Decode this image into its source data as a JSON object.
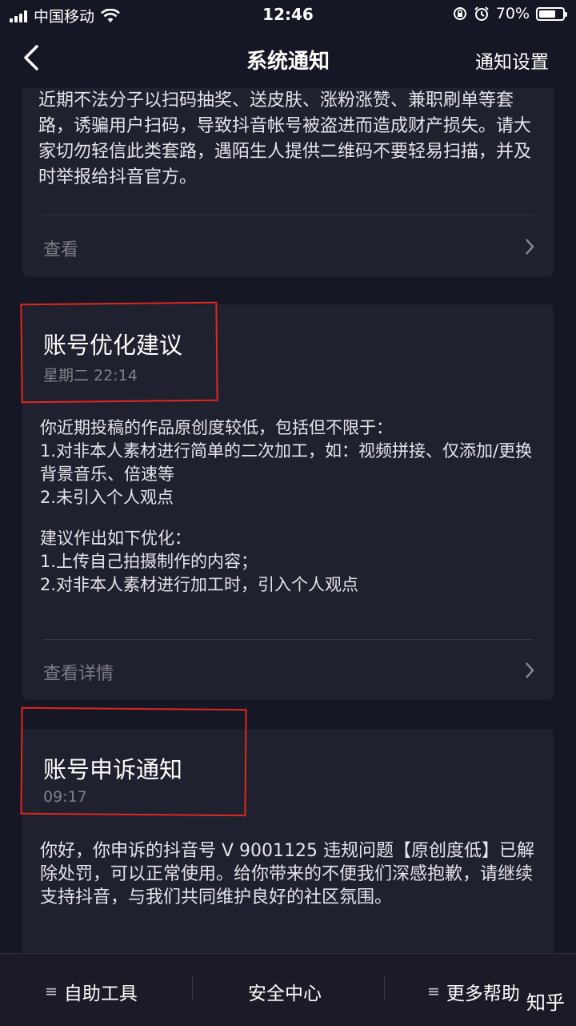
{
  "status_bar": {
    "carrier": "中国移动",
    "time": "12:46",
    "battery_pct": "70%",
    "battery_level": 0.7
  },
  "header": {
    "title": "系统通知",
    "settings_label": "通知设置"
  },
  "notice_top": {
    "body": "近期不法分子以扫码抽奖、送皮肤、涨粉涨赞、兼职刷单等套路，诱骗用户扫码，导致抖音帐号被盗进而造成财产损失。请大家切勿轻信此类套路，遇陌生人提供二维码不要轻易扫描，并及时举报给抖音官方。",
    "link": "查看"
  },
  "notice_optimize": {
    "title": "账号优化建议",
    "time": "星期二 22:14",
    "lines": [
      "你近期投稿的作品原创度较低，包括但不限于：",
      "1.对非本人素材进行简单的二次加工，如：视频拼接、仅添加/更换背景音乐、倍速等",
      "2.未引入个人观点",
      "建议作出如下优化：",
      "1.上传自己拍摄制作的内容；",
      "2.对非本人素材进行加工时，引入个人观点"
    ],
    "link": "查看详情"
  },
  "notice_appeal": {
    "title": "账号申诉通知",
    "time": "09:17",
    "body": "你好，你申诉的抖音号 V    9001125 违规问题【原创度低】已解除处罚，可以正常使用。给你带来的不便我们深感抱歉，请继续支持抖音，与我们共同维护良好的社区氛围。"
  },
  "bottom_bar": {
    "tool_1": "自助工具",
    "tool_2": "安全中心",
    "tool_3": "更多帮助"
  },
  "watermark": "知乎",
  "colors": {
    "background": "#161724",
    "card": "#20212f",
    "annotation": "#e2271e"
  }
}
